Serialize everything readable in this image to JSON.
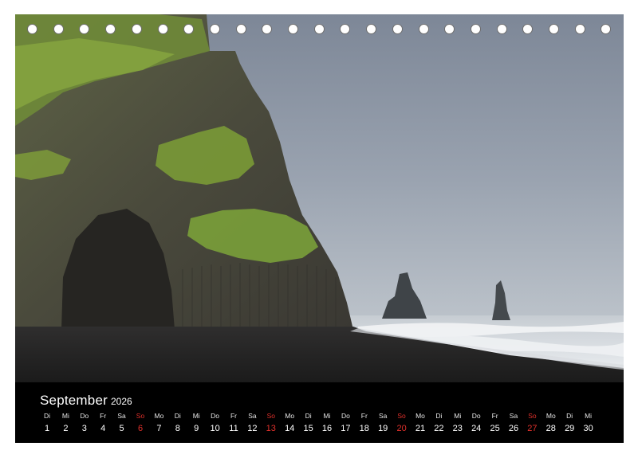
{
  "calendar": {
    "month": "September",
    "year": "2026",
    "days": [
      {
        "name": "Di",
        "num": "1",
        "sunday": false
      },
      {
        "name": "Mi",
        "num": "2",
        "sunday": false
      },
      {
        "name": "Do",
        "num": "3",
        "sunday": false
      },
      {
        "name": "Fr",
        "num": "4",
        "sunday": false
      },
      {
        "name": "Sa",
        "num": "5",
        "sunday": false
      },
      {
        "name": "So",
        "num": "6",
        "sunday": true
      },
      {
        "name": "Mo",
        "num": "7",
        "sunday": false
      },
      {
        "name": "Di",
        "num": "8",
        "sunday": false
      },
      {
        "name": "Mi",
        "num": "9",
        "sunday": false
      },
      {
        "name": "Do",
        "num": "10",
        "sunday": false
      },
      {
        "name": "Fr",
        "num": "11",
        "sunday": false
      },
      {
        "name": "Sa",
        "num": "12",
        "sunday": false
      },
      {
        "name": "So",
        "num": "13",
        "sunday": true
      },
      {
        "name": "Mo",
        "num": "14",
        "sunday": false
      },
      {
        "name": "Di",
        "num": "15",
        "sunday": false
      },
      {
        "name": "Mi",
        "num": "16",
        "sunday": false
      },
      {
        "name": "Do",
        "num": "17",
        "sunday": false
      },
      {
        "name": "Fr",
        "num": "18",
        "sunday": false
      },
      {
        "name": "Sa",
        "num": "19",
        "sunday": false
      },
      {
        "name": "So",
        "num": "20",
        "sunday": true
      },
      {
        "name": "Mo",
        "num": "21",
        "sunday": false
      },
      {
        "name": "Di",
        "num": "22",
        "sunday": false
      },
      {
        "name": "Mi",
        "num": "23",
        "sunday": false
      },
      {
        "name": "Do",
        "num": "24",
        "sunday": false
      },
      {
        "name": "Fr",
        "num": "25",
        "sunday": false
      },
      {
        "name": "Sa",
        "num": "26",
        "sunday": false
      },
      {
        "name": "So",
        "num": "27",
        "sunday": true
      },
      {
        "name": "Mo",
        "num": "28",
        "sunday": false
      },
      {
        "name": "Di",
        "num": "29",
        "sunday": false
      },
      {
        "name": "Mi",
        "num": "30",
        "sunday": false
      }
    ]
  },
  "colors": {
    "sunday": "#e0302b",
    "bar": "#000000",
    "text": "#ffffff"
  }
}
